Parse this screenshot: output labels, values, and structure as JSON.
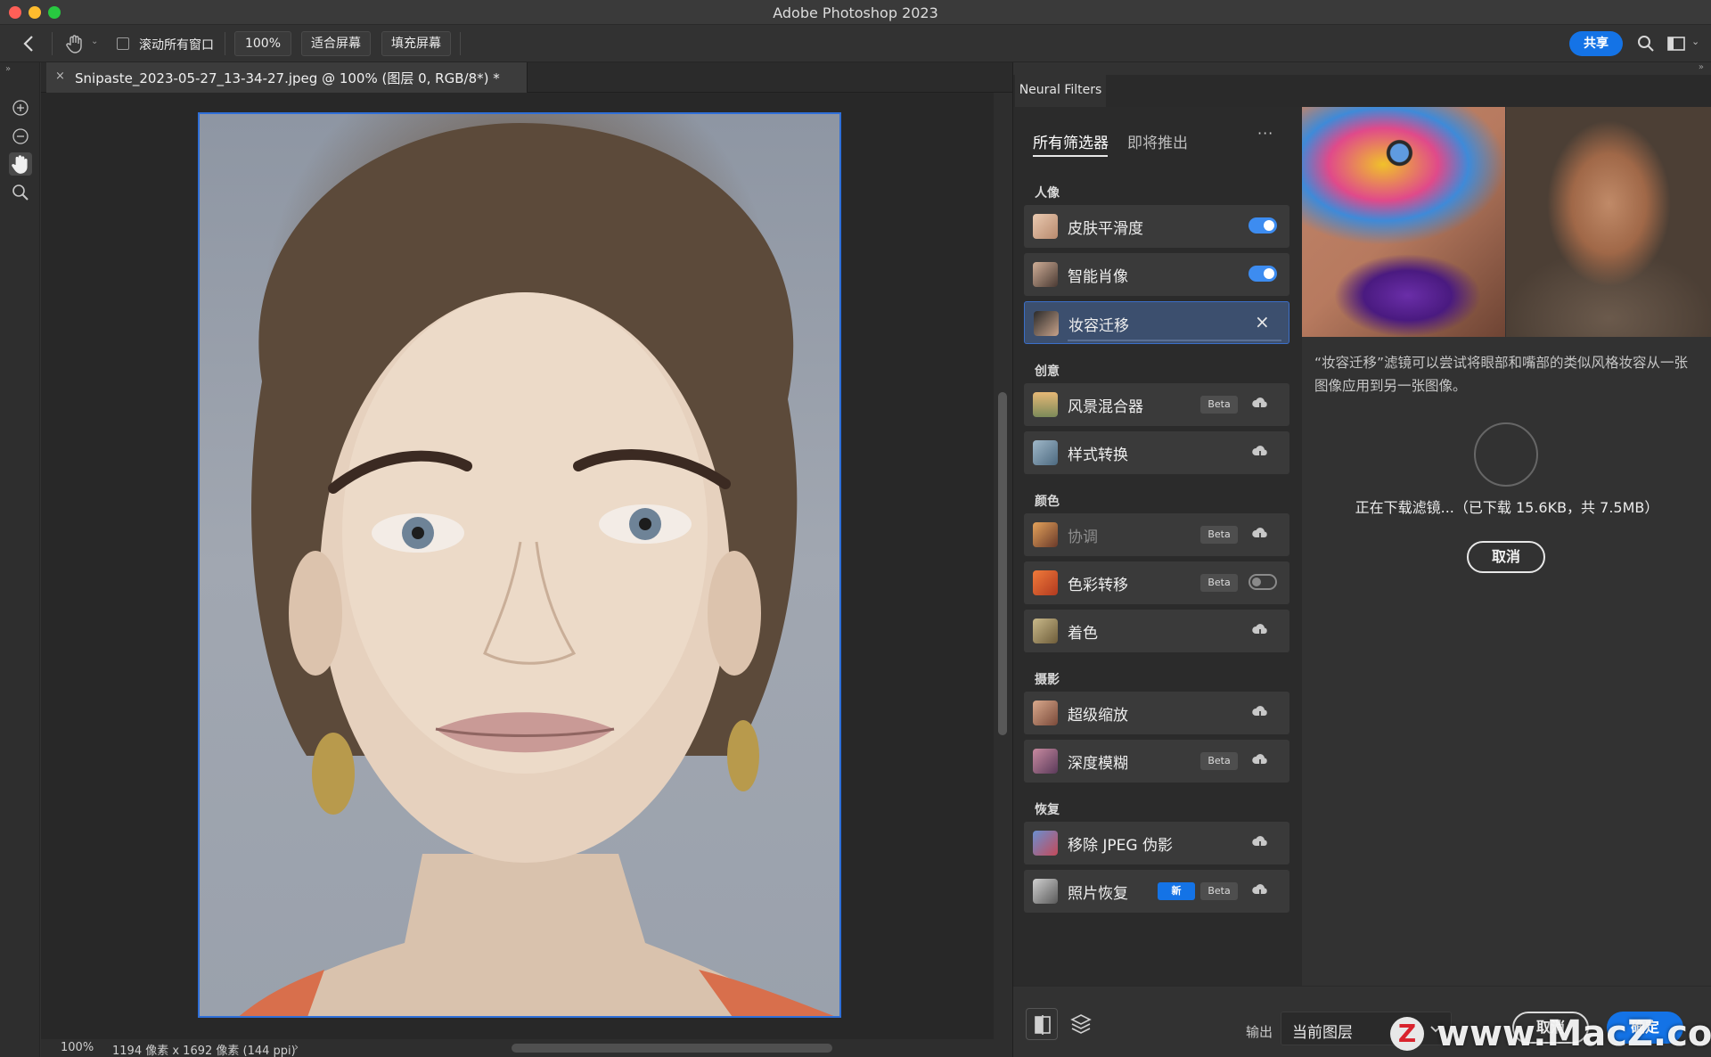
{
  "app": {
    "window_title": "Adobe Photoshop 2023"
  },
  "options_bar": {
    "scroll_all_windows": "滚动所有窗口",
    "zoom_100": "100%",
    "fit_screen": "适合屏幕",
    "fill_screen": "填充屏幕",
    "share": "共享"
  },
  "document": {
    "tab_title": "Snipaste_2023-05-27_13-34-27.jpeg @ 100% (图层 0, RGB/8*) *",
    "tab_close": "×"
  },
  "status_bar": {
    "zoom": "100%",
    "dimensions": "1194 像素 x 1692 像素 (144 ppi)"
  },
  "neural_filters": {
    "panel_title": "Neural Filters",
    "tabs": [
      "所有筛选器",
      "即将推出"
    ],
    "more": "···",
    "categories": {
      "portrait": "人像",
      "creative": "创意",
      "color": "颜色",
      "photography": "摄影",
      "restoration": "恢复"
    },
    "filters": {
      "skin_smoothing": {
        "label": "皮肤平滑度",
        "state": "on"
      },
      "smart_portrait": {
        "label": "智能肖像",
        "state": "on"
      },
      "makeup_transfer": {
        "label": "妆容迁移",
        "close": "×"
      },
      "landscape_mixer": {
        "label": "风景混合器",
        "badge": "Beta"
      },
      "style_transfer": {
        "label": "样式转换"
      },
      "harmonization": {
        "label": "协调",
        "badge": "Beta"
      },
      "color_transfer": {
        "label": "色彩转移",
        "badge": "Beta",
        "state": "off"
      },
      "colorize": {
        "label": "着色"
      },
      "super_zoom": {
        "label": "超级缩放"
      },
      "depth_blur": {
        "label": "深度模糊",
        "badge": "Beta"
      },
      "jpeg_artifacts": {
        "label": "移除 JPEG 伪影"
      },
      "photo_restoration": {
        "label": "照片恢复",
        "new": "新",
        "badge": "Beta"
      }
    },
    "detail": {
      "description": "“妆容迁移”滤镜可以尝试将眼部和嘴部的类似风格妆容从一张图像应用到另一张图像。",
      "download_status": "正在下载滤镜...（已下载 15.6KB，共 7.5MB）",
      "cancel": "取消"
    },
    "footer": {
      "output_label": "输出",
      "output_value": "当前图层",
      "cancel": "取消",
      "ok": "确定"
    }
  },
  "watermark": {
    "logo": "Z",
    "text": "www.MacZ.com"
  },
  "colors": {
    "accent": "#1473e6",
    "selection_border": "#2f6fd8"
  }
}
